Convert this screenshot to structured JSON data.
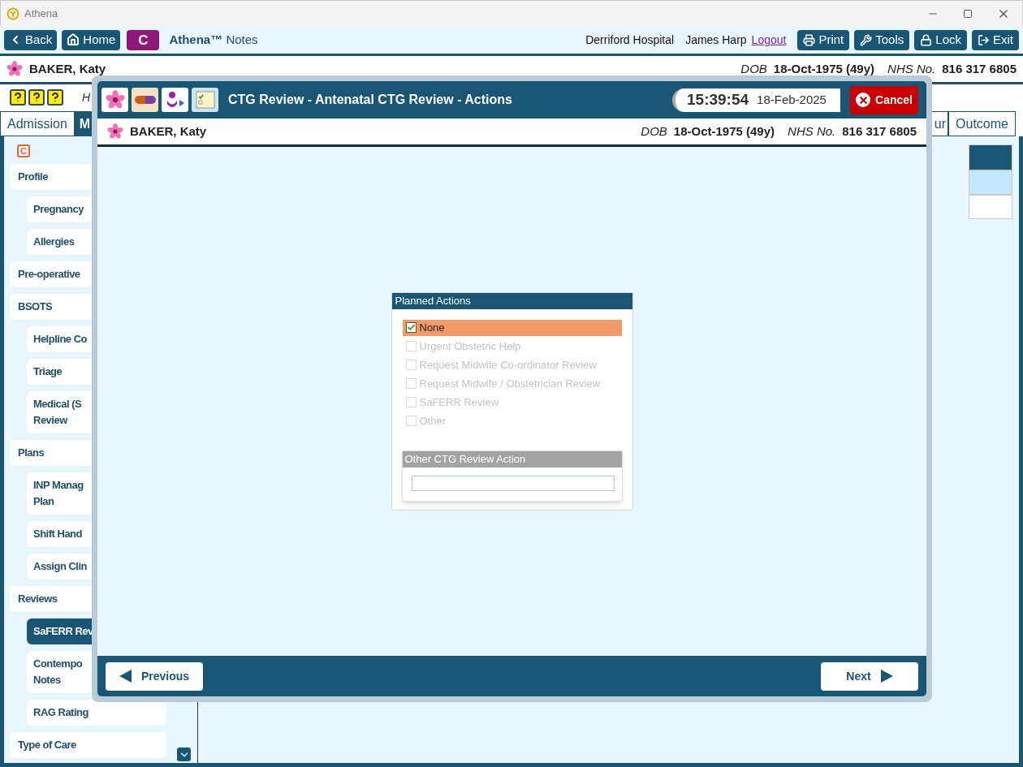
{
  "window": {
    "title": "Athena"
  },
  "toolbar": {
    "nav": [
      "Back",
      "Home"
    ],
    "badge": "C",
    "app": "**Athena™** Notes",
    "hospital": "Derriford Hospital",
    "user": "James Harp",
    "logout": "Logout",
    "actions": [
      "Print",
      "Tools",
      "Lock",
      "Exit"
    ]
  },
  "patient": {
    "name": "BAKER, Katy",
    "dob_label": "DOB",
    "dob": "18-Oct-1975 (49y)",
    "nhs_label": "NHS No.",
    "nhs": "816 317 6805"
  },
  "subbar": {
    "text": "H"
  },
  "tabs": [
    {
      "label": "Admission",
      "selected": false
    },
    {
      "label": "M",
      "selected": true
    },
    {
      "label": "ur",
      "selected": false
    },
    {
      "label": "Outcome",
      "selected": false
    }
  ],
  "sidebar": {
    "badge": "C",
    "items": [
      {
        "label": "Profile",
        "selected": false,
        "children": [
          {
            "label": "Pregnancy",
            "selected": false
          },
          {
            "label": "Allergies",
            "selected": false
          }
        ]
      },
      {
        "label": "Pre-operative",
        "selected": false
      },
      {
        "label": "BSOTS",
        "selected": false,
        "children": [
          {
            "label": "Helpline Co",
            "selected": false
          },
          {
            "label": "Triage",
            "selected": false
          },
          {
            "label": "Medical (S\nReview",
            "selected": false
          }
        ]
      },
      {
        "label": "Plans",
        "selected": false,
        "children": [
          {
            "label": "INP Manag\nPlan",
            "selected": false
          },
          {
            "label": "Shift Hand",
            "selected": false
          },
          {
            "label": "Assign Clin",
            "selected": false
          }
        ]
      },
      {
        "label": "Reviews",
        "selected": false,
        "children": [
          {
            "label": "SaFERR Rev",
            "selected": true
          },
          {
            "label": "Contempo\nNotes",
            "selected": false
          },
          {
            "label": "RAG Rating",
            "selected": false
          }
        ]
      },
      {
        "label": "Type of Care",
        "selected": false
      }
    ]
  },
  "modal": {
    "title": "CTG Review - Antenatal CTG Review - Actions",
    "time": "15:39:54",
    "date": "18-Feb-2025",
    "cancel": "Cancel",
    "patient": {
      "name": "BAKER, Katy",
      "dob_label": "DOB",
      "dob": "18-Oct-1975 (49y)",
      "nhs_label": "NHS No.",
      "nhs": "816 317 6805"
    },
    "panel": {
      "title": "Planned Actions",
      "options": [
        {
          "label": "None",
          "checked": true,
          "disabled": false
        },
        {
          "label": "Urgent Obstetric Help",
          "checked": false,
          "disabled": true
        },
        {
          "label": "Request Midwife Co-ordinator Review",
          "checked": false,
          "disabled": true
        },
        {
          "label": "Request Midwife / Obstetrician Review",
          "checked": false,
          "disabled": true
        },
        {
          "label": "SaFERR Review",
          "checked": false,
          "disabled": true
        },
        {
          "label": "Other",
          "checked": false,
          "disabled": true
        }
      ],
      "other": {
        "title": "Other CTG Review Action",
        "disabled": true
      }
    },
    "footer": {
      "previous": "Previous",
      "next": "Next"
    }
  }
}
